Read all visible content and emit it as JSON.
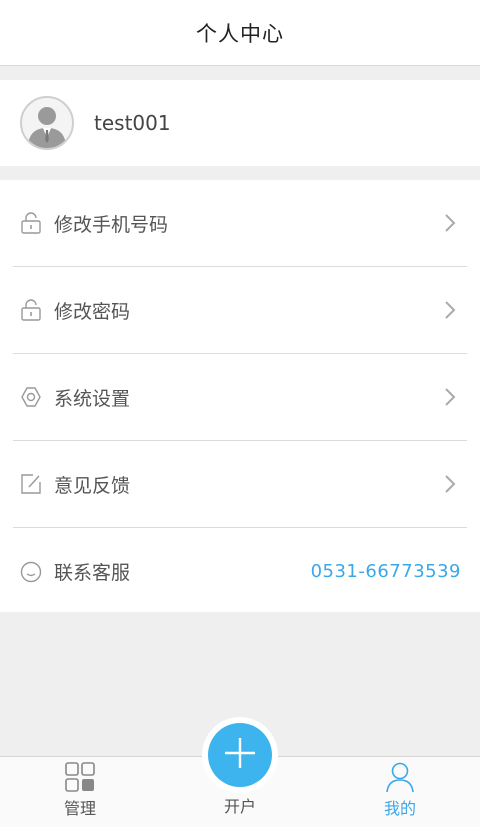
{
  "header": {
    "title": "个人中心"
  },
  "profile": {
    "username": "test001",
    "avatar_icon": "user-avatar-icon"
  },
  "menu": {
    "items": [
      {
        "label": "修改手机号码",
        "icon": "lock-icon"
      },
      {
        "label": "修改密码",
        "icon": "lock-icon"
      },
      {
        "label": "系统设置",
        "icon": "settings-icon"
      },
      {
        "label": "意见反馈",
        "icon": "edit-icon"
      },
      {
        "label": "联系客服",
        "icon": "smile-icon",
        "value": "0531-66773539"
      }
    ]
  },
  "tabbar": {
    "tabs": [
      {
        "label": "管理",
        "icon": "grid-icon"
      },
      {
        "label": "开户",
        "icon": "plus-icon"
      },
      {
        "label": "我的",
        "icon": "person-icon",
        "active": true
      }
    ]
  },
  "colors": {
    "accent": "#3aa8e8",
    "plus_button": "#3db4ee",
    "background": "#efefef"
  }
}
